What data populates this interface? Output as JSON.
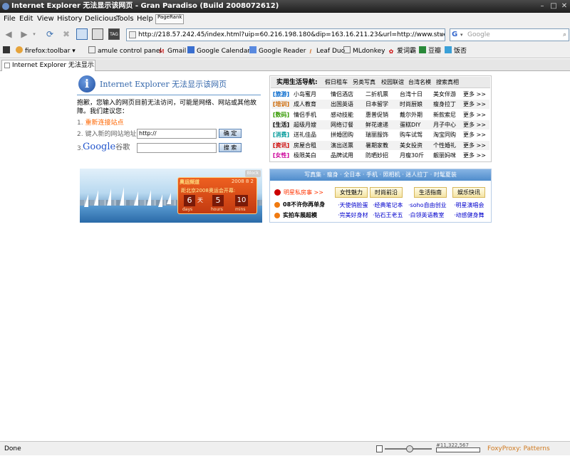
{
  "window": {
    "title": "Internet Explorer 无法显示该网页 - Gran Paradiso (Build 2008072612)"
  },
  "menu": {
    "items": [
      "File",
      "Edit",
      "View",
      "History",
      "Delicious",
      "Tools",
      "Help"
    ],
    "pagerank_label": "PageRank"
  },
  "navbar": {
    "url": "http://218.57.242.45/index.html?uip=60.216.198.180&dip=163.16.211.23&url=http://www.study",
    "search_placeholder": "Google",
    "search_engine": "G"
  },
  "bookmarks": [
    "firefox:toolbar",
    "amule control panel",
    "Gmail",
    "Google Calendar",
    "Google Reader",
    "Leaf Duo",
    "MLdonkey",
    "爱词霸",
    "豆瓣",
    "饭否"
  ],
  "tab": {
    "title": "Internet Explorer 无法显示..."
  },
  "error": {
    "title": "Internet Explorer 无法显示该网页",
    "message": "抱歉，您输入的网页目前无法访问，可能是网络、网站或其他故障。我们建议您：",
    "step1_num": "1.",
    "step1": "重新连接站点",
    "step2": "2. 键入新的网站地址",
    "step2_value": "http://",
    "step3_num": "3.",
    "go_button": "确 定",
    "search_button": "搜 索",
    "google_logo": "Google",
    "google_suffix": "谷歌"
  },
  "life_nav": {
    "title": "实用生活导航:",
    "links": [
      "假日租车",
      "另类写真",
      "校园联谊",
      "台湾名模",
      "搜索真相"
    ],
    "rows": [
      {
        "cat": "[旅游]",
        "color": "#0066cc",
        "items": [
          "小岛蜜月",
          "情侣酒店",
          "二折机票",
          "台湾十日",
          "美女伴游",
          "更多 >>"
        ]
      },
      {
        "cat": "[培训]",
        "color": "#cc6600",
        "items": [
          "成人教育",
          "出国英语",
          "日本留学",
          "时尚厨娘",
          "瘦身拉丁",
          "更多 >>"
        ]
      },
      {
        "cat": "[数码]",
        "color": "#339900",
        "items": [
          "情侣手机",
          "感动技能",
          "惠普促销",
          "戴尔外期",
          "新款索尼",
          "更多 >>"
        ]
      },
      {
        "cat": "[生活]",
        "color": "#000000",
        "items": [
          "超级月嫂",
          "网络订餐",
          "鲜花速递",
          "蛋糕DIY",
          "月子中心",
          "更多 >>"
        ]
      },
      {
        "cat": "[消费]",
        "color": "#009999",
        "items": [
          "送礼佳品",
          "拼婚团购",
          "瑞丽服饰",
          "购车试驾",
          "淘宝同购",
          "更多 >>"
        ]
      },
      {
        "cat": "[资讯]",
        "color": "#cc0000",
        "items": [
          "房屋合租",
          "演出送票",
          "暑期家教",
          "美女投资",
          "个性婚礼",
          "更多 >>"
        ]
      },
      {
        "cat": "[女性]",
        "color": "#cc0099",
        "items": [
          "极限美白",
          "品牌试用",
          "防晒妙招",
          "月瘦30斤",
          "靓丽妈咪",
          "更多 >>"
        ]
      }
    ]
  },
  "olympic_ad": {
    "badge": "奥运频道",
    "date": "2008 8 2",
    "headline": "距北京2008奥运会开幕:",
    "days": "6",
    "days_unit": "天",
    "hours": "5",
    "minutes": "10",
    "labels": [
      "days",
      "hours",
      "mins"
    ],
    "close": "Block"
  },
  "promo": {
    "header": "写真集 · 瘦身 · 全日本 · 手机 · 照相机 · 迷人拉丁 · 时髦夏装",
    "star_label": "明星私房事 >>",
    "tabs": [
      "女性魅力",
      "时尚前沿",
      "生活指南",
      "娱乐快讯"
    ],
    "left_items": [
      "08不许你再单身",
      "实拍车展超模"
    ],
    "links_row1": [
      "·天使俏脸蛋",
      "·经典笔记本",
      "·soho自由创业",
      "·明星演唱会"
    ],
    "links_row2": [
      "·完美好身材",
      "·钻石王老五",
      "·白领英语教室",
      "·动感健身舞"
    ]
  },
  "status": {
    "text": "Done",
    "counter": "#11,322,567",
    "proxy": "FoxyProxy: Patterns"
  }
}
